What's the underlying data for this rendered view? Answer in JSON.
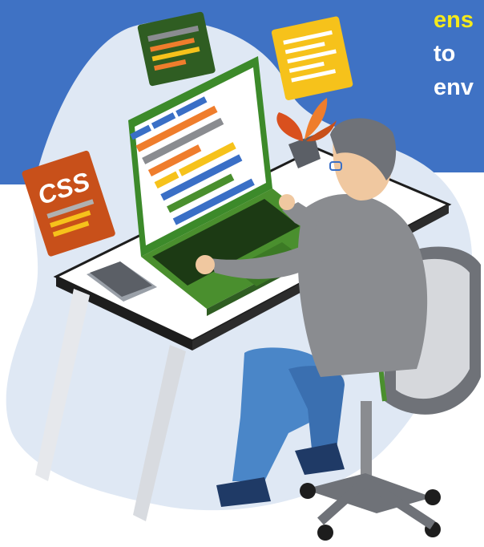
{
  "banner": {
    "line1": "ens",
    "line2": "to",
    "line3": "env"
  },
  "badge": {
    "css_label": "CSS"
  },
  "colors": {
    "banner_blue": "#3f72c4",
    "blob": "#dfe8f4",
    "highlight_yellow": "#f5ea1a",
    "laptop_green": "#4a8f2e",
    "code_orange": "#ef7d2c",
    "code_yellow": "#f6c21b",
    "code_blue": "#3a6fc6",
    "chair_gray": "#6f7278",
    "shirt_gray": "#8a8c90",
    "jeans_blue": "#4a86c8"
  },
  "icons": [
    "css-badge-icon",
    "code-window-icon",
    "document-icon",
    "plant-icon",
    "phone-icon"
  ]
}
